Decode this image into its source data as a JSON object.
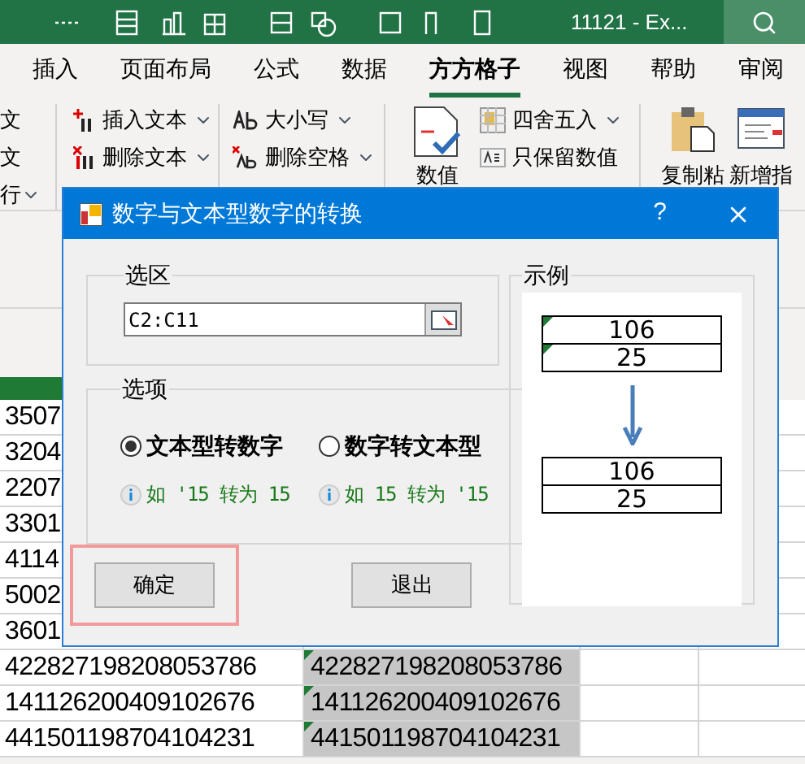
{
  "window": {
    "title": "11121 - Ex..."
  },
  "ribbon_tabs": [
    {
      "label": "插入",
      "selected": false
    },
    {
      "label": "页面布局",
      "selected": false
    },
    {
      "label": "公式",
      "selected": false
    },
    {
      "label": "数据",
      "selected": false
    },
    {
      "label": "方方格子",
      "selected": true
    },
    {
      "label": "视图",
      "selected": false
    },
    {
      "label": "帮助",
      "selected": false
    },
    {
      "label": "审阅",
      "selected": false
    }
  ],
  "ribbon_left": [
    "文",
    "文",
    "行"
  ],
  "ribbon_col1": [
    {
      "label": "插入文本",
      "kind": "insert"
    },
    {
      "label": "删除文本",
      "kind": "delete"
    }
  ],
  "ribbon_col2": [
    {
      "label": "大小写",
      "kind": "case"
    },
    {
      "label": "删除空格",
      "kind": "space"
    }
  ],
  "ribbon_big": {
    "label": "数值"
  },
  "ribbon_col3": [
    {
      "label": "四舍五入",
      "kind": "round"
    },
    {
      "label": "只保留数值",
      "kind": "keep"
    }
  ],
  "ribbon_right": [
    {
      "label": "复制粘",
      "kind": "paste"
    },
    {
      "label": "新增指",
      "kind": "new"
    }
  ],
  "sheet_rows": [
    {
      "a": "3507"
    },
    {
      "a": "3204"
    },
    {
      "a": "2207"
    },
    {
      "a": "3301"
    },
    {
      "a": "4114"
    },
    {
      "a": "5002"
    },
    {
      "a": "3601"
    },
    {
      "a": "422827198208053786",
      "b": "422827198208053786",
      "selected": true,
      "text_format": true
    },
    {
      "a": "141126200409102676",
      "b": "141126200409102676",
      "selected": true,
      "text_format": true
    },
    {
      "a": "441501198704104231",
      "b": "441501198704104231",
      "selected": true,
      "text_format": true
    }
  ],
  "dialog": {
    "title": "数字与文本型数字的转换",
    "help": "?",
    "range_group": {
      "label": "选区",
      "value": "C2:C11"
    },
    "options_group": {
      "label": "选项",
      "options": [
        {
          "label": "文本型转数字",
          "selected": true,
          "hint": "如 '15 转为 15"
        },
        {
          "label": "数字转文本型",
          "selected": false,
          "hint": "如 15 转为 '15"
        }
      ]
    },
    "example": {
      "label": "示例",
      "before": [
        {
          "value": "106",
          "text_format": true
        },
        {
          "value": "25",
          "text_format": true
        }
      ],
      "after": [
        {
          "value": "106",
          "text_format": false
        },
        {
          "value": "25",
          "text_format": false
        }
      ]
    },
    "buttons": [
      {
        "label": "确定",
        "highlighted": true
      },
      {
        "label": "退出",
        "highlighted": false
      }
    ]
  }
}
